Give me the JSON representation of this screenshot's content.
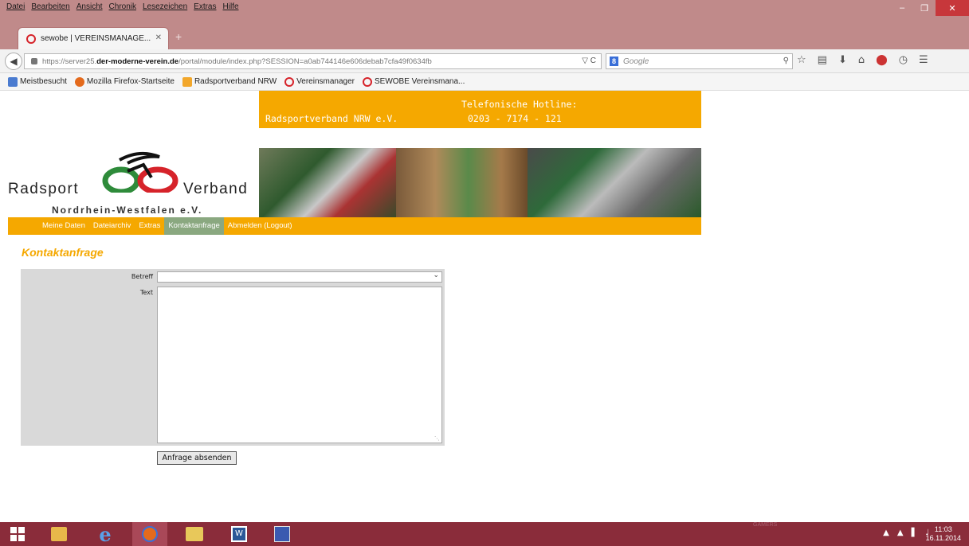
{
  "browser": {
    "menu": [
      "Datei",
      "Bearbeiten",
      "Ansicht",
      "Chronik",
      "Lesezeichen",
      "Extras",
      "Hilfe"
    ],
    "tab_title": "sewobe | VEREINSMANAGE...",
    "url_prefix": "https://server25.",
    "url_domain": "der-moderne-verein.de",
    "url_suffix": "/portal/module/index.php?SESSION=a0ab744146e606debab7cfa49f0634fb",
    "search_placeholder": "Google",
    "bookmarks": [
      "Meistbesucht",
      "Mozilla Firefox-Startseite",
      "Radsportverband NRW",
      "Vereinsmanager",
      "SEWOBE Vereinsmana..."
    ]
  },
  "header": {
    "org_name": "Radsportverband NRW e.V.",
    "hotline_label": "Telefonische Hotline:",
    "hotline_number": "0203 - 7174 - 121"
  },
  "logo": {
    "word_left": "Radsport",
    "word_right": "Verband",
    "subtitle": "Nordrhein-Westfalen e.V."
  },
  "nav": {
    "items": [
      "Meine Daten",
      "Dateiarchiv",
      "Extras",
      "Kontaktanfrage",
      "Abmelden (Logout)"
    ],
    "active": "Kontaktanfrage"
  },
  "page": {
    "title": "Kontaktanfrage",
    "subject_label": "Betreff",
    "subject_value": "",
    "text_label": "Text",
    "text_value": "",
    "submit_label": "Anfrage absenden"
  },
  "taskbar": {
    "time": "11:03",
    "date": "16.11.2014",
    "tray_label": "GAMERS"
  },
  "colors": {
    "accent": "#f5a800",
    "nav_active": "#8aa880",
    "titlebar": "#c08a8a",
    "taskbar": "#8a2c3a"
  }
}
